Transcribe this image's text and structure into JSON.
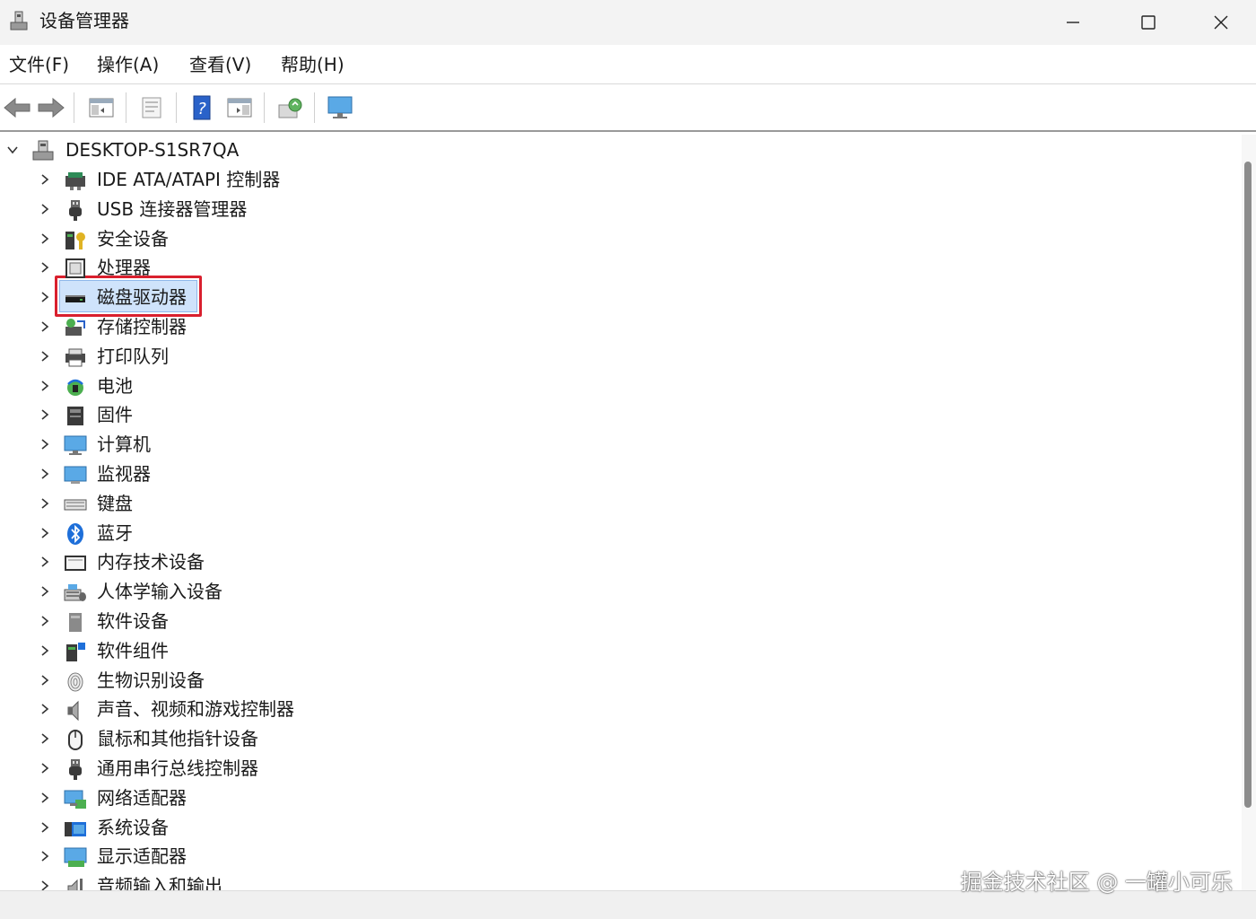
{
  "window": {
    "title": "设备管理器"
  },
  "menu": [
    "文件(F)",
    "操作(A)",
    "查看(V)",
    "帮助(H)"
  ],
  "toolbar": {
    "icons": [
      "back-arrow-icon",
      "forward-arrow-icon",
      "show-hide-tree-icon",
      "properties-icon",
      "help-icon",
      "action-pane-icon",
      "scan-hardware-icon",
      "monitor-icon"
    ]
  },
  "tree": {
    "root": "DESKTOP-S1SR7QA",
    "selected_index": 4,
    "items": [
      {
        "label": "IDE ATA/ATAPI 控制器",
        "icon": "ide-controller-icon"
      },
      {
        "label": "USB 连接器管理器",
        "icon": "usb-plug-icon"
      },
      {
        "label": "安全设备",
        "icon": "security-key-icon"
      },
      {
        "label": "处理器",
        "icon": "cpu-icon"
      },
      {
        "label": "磁盘驱动器",
        "icon": "disk-drive-icon"
      },
      {
        "label": "存储控制器",
        "icon": "storage-controller-icon"
      },
      {
        "label": "打印队列",
        "icon": "printer-icon"
      },
      {
        "label": "电池",
        "icon": "battery-icon"
      },
      {
        "label": "固件",
        "icon": "firmware-icon"
      },
      {
        "label": "计算机",
        "icon": "computer-icon"
      },
      {
        "label": "监视器",
        "icon": "monitor-icon"
      },
      {
        "label": "键盘",
        "icon": "keyboard-icon"
      },
      {
        "label": "蓝牙",
        "icon": "bluetooth-icon"
      },
      {
        "label": "内存技术设备",
        "icon": "memory-icon"
      },
      {
        "label": "人体学输入设备",
        "icon": "hid-icon"
      },
      {
        "label": "软件设备",
        "icon": "software-device-icon"
      },
      {
        "label": "软件组件",
        "icon": "software-component-icon"
      },
      {
        "label": "生物识别设备",
        "icon": "fingerprint-icon"
      },
      {
        "label": "声音、视频和游戏控制器",
        "icon": "speaker-icon"
      },
      {
        "label": "鼠标和其他指针设备",
        "icon": "mouse-icon"
      },
      {
        "label": "通用串行总线控制器",
        "icon": "usb-plug-icon"
      },
      {
        "label": "网络适配器",
        "icon": "network-adapter-icon"
      },
      {
        "label": "系统设备",
        "icon": "system-device-icon"
      },
      {
        "label": "显示适配器",
        "icon": "display-adapter-icon"
      },
      {
        "label": "音频输入和输出",
        "icon": "audio-io-icon"
      }
    ]
  },
  "watermark": "掘金技术社区 @ 一罐小可乐",
  "colors": {
    "highlight_border": "#d9202e",
    "selection": "#cfe3fb",
    "accent": "#1e6fd9"
  }
}
